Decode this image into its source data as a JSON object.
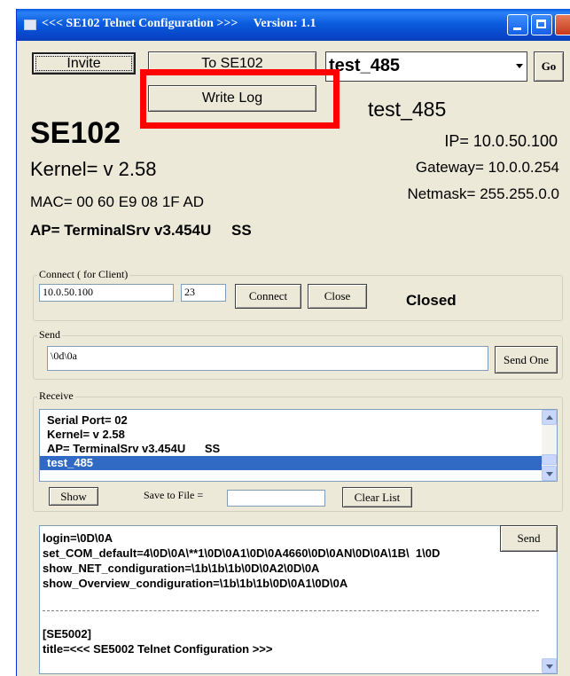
{
  "window": {
    "title": "<<< SE102 Telnet Configuration >>>     Version: 1.1"
  },
  "toolbar": {
    "invite_label": "Invite",
    "to_device_label": "To SE102",
    "write_log_label": "Write Log",
    "device_select_value": "test_485",
    "go_label": "Go"
  },
  "device": {
    "model": "SE102",
    "kernel": "Kernel= v 2.58",
    "mac": "MAC= 00 60 E9 08 1F AD",
    "ap": "AP= TerminalSrv v3.454U",
    "ap_flag": "SS",
    "name": "test_485",
    "ip": "IP= 10.0.50.100",
    "gateway": "Gateway= 10.0.0.254",
    "netmask": "Netmask= 255.255.0.0"
  },
  "connect": {
    "group_title": "Connect ( for Client)",
    "ip_value": "10.0.50.100",
    "port_value": "23",
    "connect_label": "Connect",
    "close_label": "Close",
    "status": "Closed"
  },
  "send": {
    "group_title": "Send",
    "value": "\\0d\\0a",
    "send_one_label": "Send One"
  },
  "receive": {
    "group_title": "Receive",
    "items": [
      "Serial Port= 02",
      "Kernel= v 2.58",
      "AP= TerminalSrv v3.454U      SS",
      "test_485"
    ],
    "show_label": "Show",
    "save_to_file_label": "Save to File =",
    "save_to_file_value": "",
    "clear_list_label": "Clear List"
  },
  "log": {
    "send_label": "Send",
    "lines": [
      "login=\\0D\\0A",
      "set_COM_default=4\\0D\\0A\\**1\\0D\\0A1\\0D\\0A4660\\0D\\0AN\\0D\\0A\\1B\\  1\\0D",
      "show_NET_condiguration=\\1b\\1b\\1b\\0D\\0A2\\0D\\0A",
      "show_Overview_condiguration=\\1b\\1b\\1b\\0D\\0A1\\0D\\0A",
      "",
      "",
      "[SE5002]",
      "title=<<< SE5002 Telnet Configuration >>>"
    ]
  },
  "colors": {
    "annotation": "#ff0000",
    "selection": "#316ac5",
    "titlebar": "#0a5ce6"
  }
}
